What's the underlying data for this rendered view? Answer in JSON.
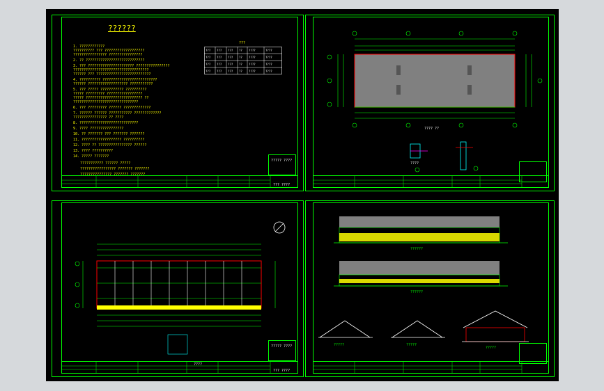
{
  "sheet1": {
    "title": "??????",
    "notes": [
      "1. ????????????",
      "  ?????????? ??? ???????????????????",
      "  ???????????????? ????????????????",
      "2. ?? ????????????????????????????",
      "3. ??? ?????????????????????? ????????????????",
      "   ????????????????????????????????????",
      "   ??????  ??? ??????????????????????????",
      "4. ?????????? ??????????????????????????",
      "   ?????? ??????????????????? ???????????",
      "5. ??? ????? ??????????? ??????????",
      "   ????? ????????? ?????????????????",
      "   ????? ??????????????????????????? ??",
      "   ???????????????????????????????",
      "6. ??? ????????? ?????? ?????????????",
      "7. ?????? ?????? ??????????? ?????????????",
      "   ???????????????? ?? ????",
      "8. ????????????????????????????",
      "9. ???? ????????????????",
      "10. ?? ??????? ??? ??????? ???????",
      "11. ??????????????????? ??????????",
      "12. ???? ?? ???????????????? ??????",
      "13. ???? ??????????",
      "14. ????? ???????"
    ],
    "legend": [
      "??????????? ?????? ?????",
      "????????????????? ??????? ???????",
      "??????????????? ??????? ???????"
    ],
    "table_title": "???",
    "table_rows": [
      [
        "???",
        "???",
        "???",
        "??",
        "????",
        "????"
      ],
      [
        "???",
        "???",
        "???",
        "??",
        "????",
        "????"
      ],
      [
        "???",
        "???",
        "???",
        "??",
        "????",
        "????"
      ],
      [
        "???",
        "???",
        "???",
        "??",
        "????",
        "????"
      ]
    ],
    "stamp": "????? ????",
    "footer": "??? ????"
  },
  "sheet2": {
    "caption": "???? ??",
    "detail_caption": "????"
  },
  "sheet3": {
    "caption": "????",
    "stamp": "????? ????",
    "footer": "??? ????"
  },
  "sheet4": {
    "elev1_caption": "??????",
    "elev2_caption": "??????",
    "sec1_caption": "?????",
    "sec2_caption": "?????",
    "sec3_caption": "?????"
  },
  "colors": {
    "frame": "#00ff00",
    "text": "#ffff00",
    "roof": "#808080",
    "wall": "#ff0000",
    "background": "#000000"
  }
}
